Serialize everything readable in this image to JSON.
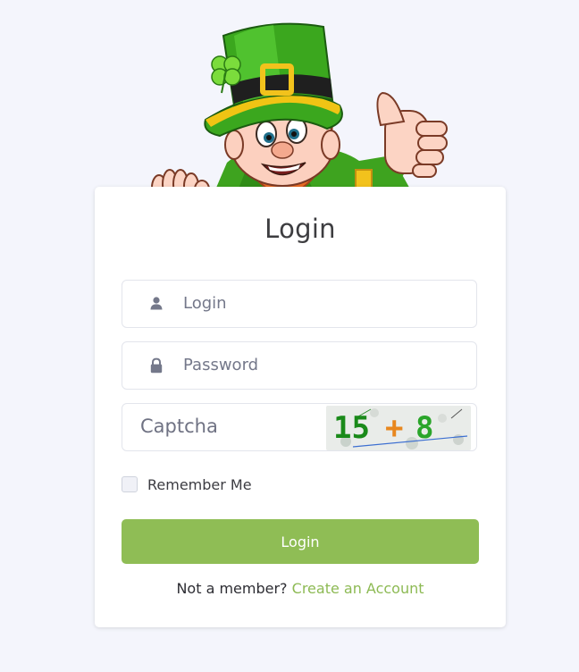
{
  "form": {
    "title": "Login",
    "login_placeholder": "Login",
    "password_placeholder": "Password",
    "captcha_placeholder": "Captcha",
    "captcha_text": {
      "a": "15",
      "op": "+",
      "b": "8"
    },
    "remember_label": "Remember Me",
    "remember_checked": false,
    "submit_label": "Login",
    "footer_text": "Not a member?",
    "footer_link": "Create an Account"
  },
  "icons": {
    "login": "user-icon",
    "password": "lock-icon"
  },
  "colors": {
    "background": "#f4f5fc",
    "accent": "#8fbd55",
    "link": "#8dba54",
    "captcha_digits": "#1a8a1a",
    "captcha_operator": "#e8871e"
  }
}
